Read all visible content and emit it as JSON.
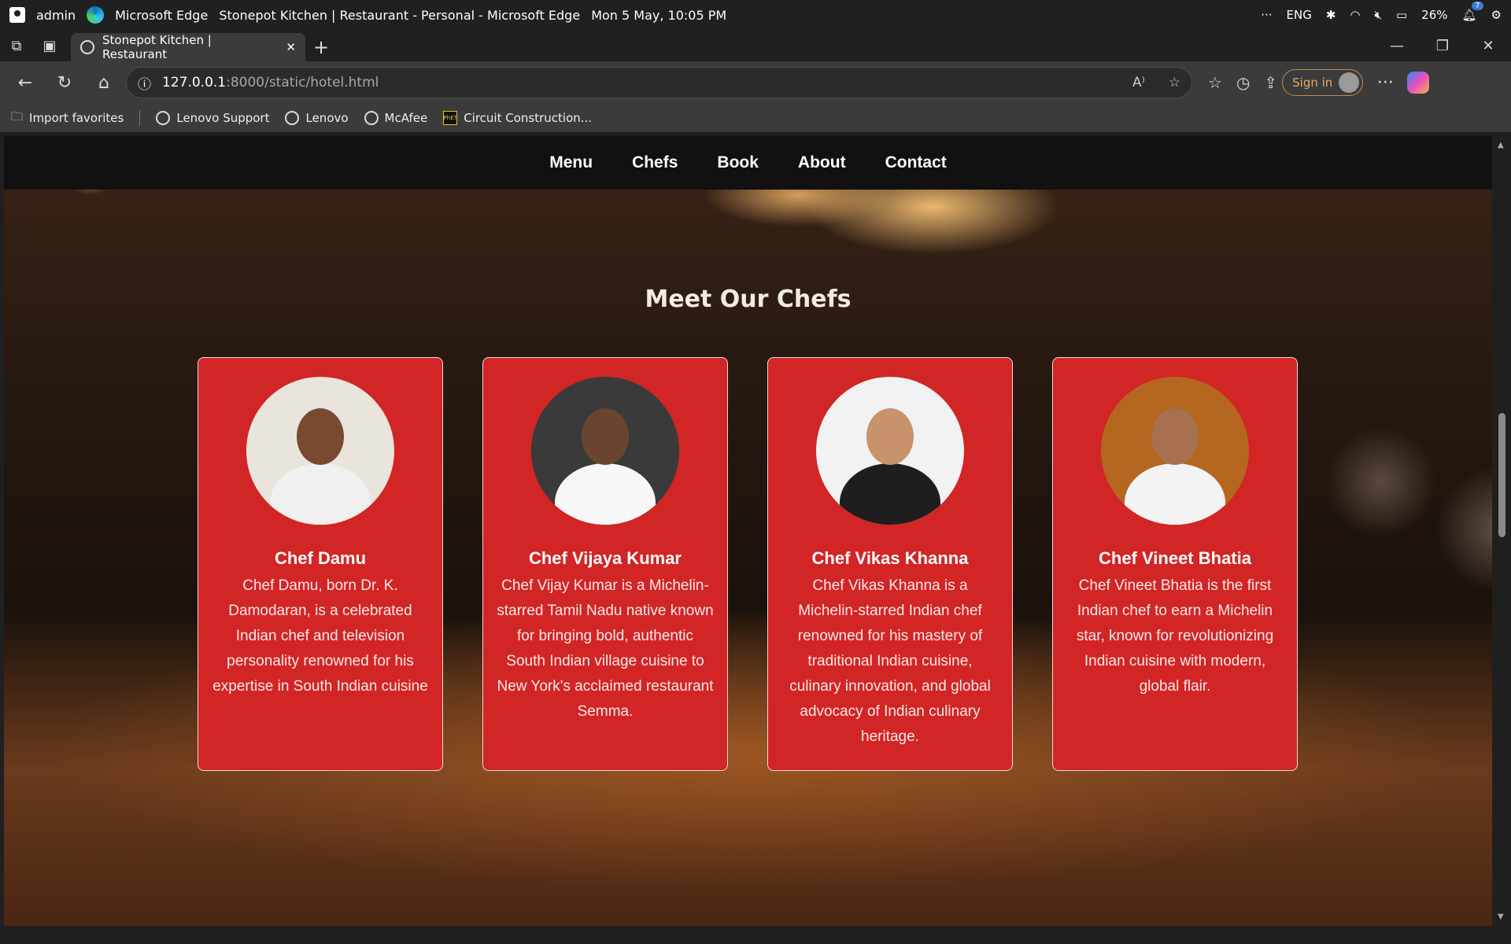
{
  "system": {
    "user": "admin",
    "app": "Microsoft Edge",
    "window_title": "Stonepot Kitchen | Restaurant - Personal - Microsoft Edge",
    "datetime": "Mon 5 May, 10:05 PM",
    "language": "ENG",
    "battery": "26%",
    "notifications": "7"
  },
  "browser": {
    "tab_title": "Stonepot Kitchen | Restaurant",
    "url_host": "127.0.0.1",
    "url_path": ":8000/static/hotel.html",
    "signin_label": "Sign in",
    "favorites": [
      "Import favorites",
      "Lenovo Support",
      "Lenovo",
      "McAfee",
      "Circuit Construction..."
    ]
  },
  "site": {
    "nav": [
      "Menu",
      "Chefs",
      "Book",
      "About",
      "Contact"
    ],
    "section_title": "Meet Our Chefs",
    "chefs": [
      {
        "name": "Chef Damu",
        "bio": "Chef Damu, born Dr. K. Damodaran, is a celebrated Indian chef and television personality renowned for his expertise in South Indian cuisine",
        "photo_bg": "#e9e4dc",
        "skin": "#7a4a30",
        "coat": "#f0f0f0"
      },
      {
        "name": "Chef Vijaya Kumar",
        "bio": "Chef Vijay Kumar is a Michelin-starred Tamil Nadu native known for bringing bold, authentic South Indian village cuisine to New York's acclaimed restaurant Semma.",
        "photo_bg": "#3a3a3a",
        "skin": "#6b4430",
        "coat": "#f7f7f7"
      },
      {
        "name": "Chef Vikas Khanna",
        "bio": "Chef Vikas Khanna is a Michelin-starred Indian chef renowned for his mastery of traditional Indian cuisine, culinary innovation, and global advocacy of Indian culinary heritage.",
        "photo_bg": "#f2f2f2",
        "skin": "#c8926c",
        "coat": "#1e1e1e"
      },
      {
        "name": "Chef Vineet Bhatia",
        "bio": "Chef Vineet Bhatia is the first Indian chef to earn a Michelin star, known for revolutionizing Indian cuisine with modern, global flair.",
        "photo_bg": "#b5661f",
        "skin": "#a7704e",
        "coat": "#f3f3f3"
      }
    ]
  }
}
